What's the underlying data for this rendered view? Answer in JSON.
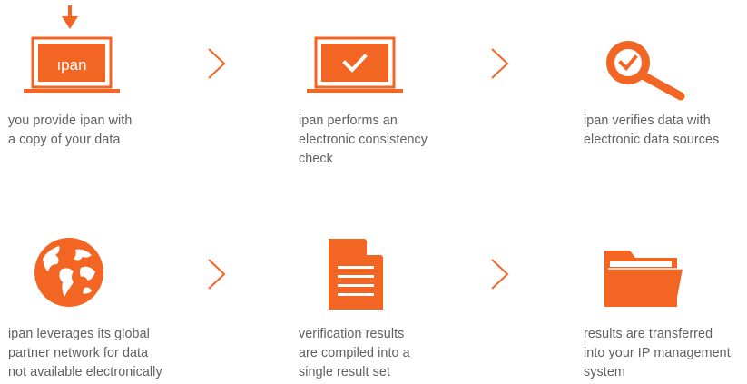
{
  "colors": {
    "accent": "#f26522",
    "text": "#5f5f5f"
  },
  "steps": [
    {
      "icon": "laptop-download-icon",
      "logo_text": "ıpan",
      "lines": [
        "you provide ipan with",
        "a copy of your data"
      ]
    },
    {
      "icon": "laptop-check-icon",
      "lines": [
        "ipan performs an",
        "electronic consistency",
        "check"
      ]
    },
    {
      "icon": "magnifier-check-icon",
      "lines": [
        "ipan verifies data with",
        "electronic data sources"
      ]
    },
    {
      "icon": "globe-icon",
      "lines": [
        "ipan leverages its global",
        "partner network for data",
        "not available electronically"
      ]
    },
    {
      "icon": "document-icon",
      "lines": [
        "verification results",
        "are compiled into a",
        "single result set"
      ]
    },
    {
      "icon": "folder-icon",
      "lines": [
        "results are transferred",
        "into your IP management",
        "system"
      ]
    }
  ]
}
